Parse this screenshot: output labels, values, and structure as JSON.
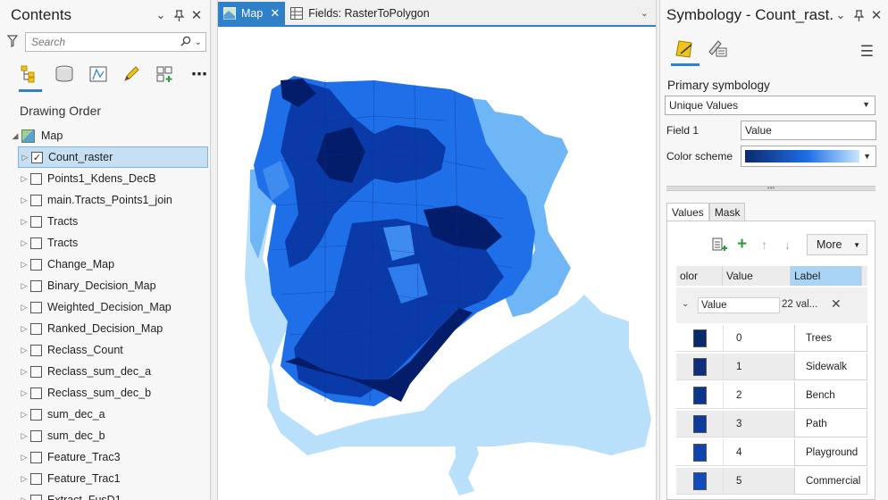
{
  "contents": {
    "title": "Contents",
    "search_placeholder": "Search",
    "drawing_order_label": "Drawing Order",
    "map_label": "Map",
    "layers": [
      {
        "label": "Count_raster",
        "checked": true,
        "selected": true
      },
      {
        "label": "Points1_Kdens_DecB",
        "checked": false
      },
      {
        "label": "main.Tracts_Points1_join",
        "checked": false
      },
      {
        "label": "Tracts",
        "checked": false
      },
      {
        "label": "Tracts",
        "checked": false
      },
      {
        "label": "Change_Map",
        "checked": false
      },
      {
        "label": "Binary_Decision_Map",
        "checked": false
      },
      {
        "label": "Weighted_Decision_Map",
        "checked": false
      },
      {
        "label": "Ranked_Decision_Map",
        "checked": false
      },
      {
        "label": "Reclass_Count",
        "checked": false
      },
      {
        "label": "Reclass_sum_dec_a",
        "checked": false
      },
      {
        "label": "Reclass_sum_dec_b",
        "checked": false
      },
      {
        "label": "sum_dec_a",
        "checked": false
      },
      {
        "label": "sum_dec_b",
        "checked": false
      },
      {
        "label": "Feature_Trac3",
        "checked": false
      },
      {
        "label": "Feature_Trac1",
        "checked": false
      },
      {
        "label": "Extract_FusD1",
        "checked": false
      }
    ]
  },
  "tabs": {
    "map_tab": "Map",
    "fields_tab": "Fields:  RasterToPolygon"
  },
  "symbology": {
    "title": "Symbology - Count_rast...",
    "primary_label": "Primary symbology",
    "renderer": "Unique Values",
    "field1_label": "Field 1",
    "field1_value": "Value",
    "color_scheme_label": "Color scheme",
    "subtab_values": "Values",
    "subtab_mask": "Mask",
    "more_label": "More",
    "columns": [
      "olor",
      "Value",
      "Label"
    ],
    "group_field": "Value",
    "group_count": "22 val...",
    "rows": [
      {
        "value": "0",
        "label": "Trees",
        "color": "#0a2a6e"
      },
      {
        "value": "1",
        "label": "Sidewalk",
        "color": "#0b2f7d"
      },
      {
        "value": "2",
        "label": "Bench",
        "color": "#0c358c"
      },
      {
        "value": "3",
        "label": "Path",
        "color": "#0d3c9c"
      },
      {
        "value": "4",
        "label": "Playground",
        "color": "#0e44ab"
      },
      {
        "value": "5",
        "label": "Commercial",
        "color": "#0f4cba"
      }
    ]
  },
  "colors": {
    "accent": "#2f80c8",
    "map_darkest": "#041d6b",
    "map_dark": "#0a3aa8",
    "map_mid": "#1e6fe8",
    "map_light": "#6fb6f7",
    "map_lightest": "#b8e0fb"
  }
}
